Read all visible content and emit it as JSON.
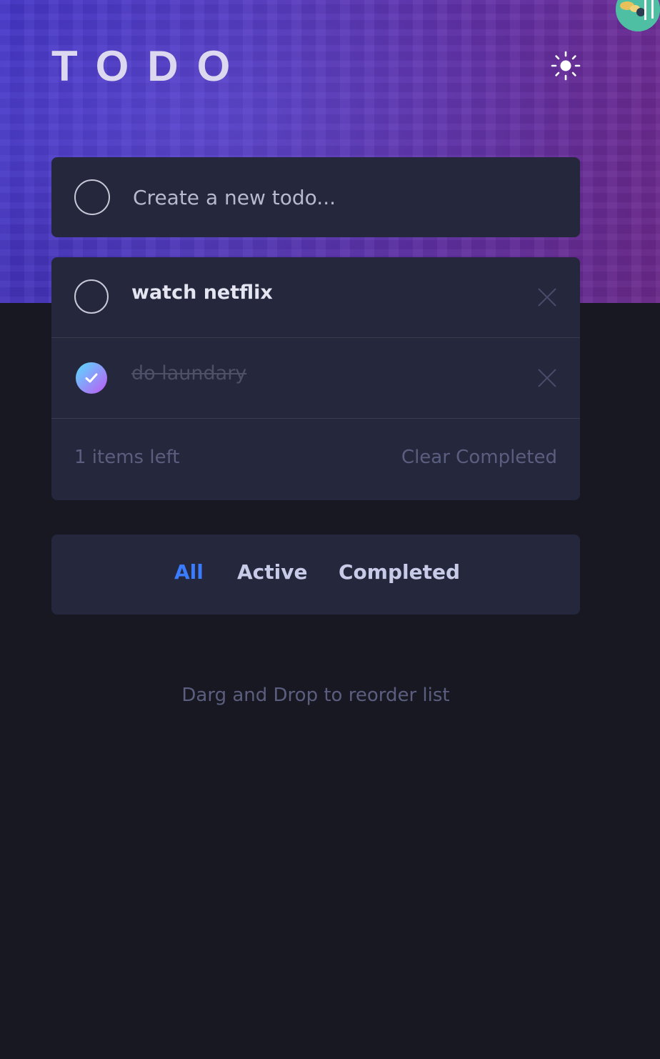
{
  "header": {
    "title": "TODO",
    "theme_icon": "sun-icon"
  },
  "new_todo": {
    "placeholder": "Create a new todo..."
  },
  "todos": [
    {
      "text": "watch netflix",
      "completed": false
    },
    {
      "text": "do laundary",
      "completed": true
    }
  ],
  "footer": {
    "items_left": "1 items left",
    "clear_label": "Clear Completed"
  },
  "filters": {
    "all": "All",
    "active": "Active",
    "completed": "Completed",
    "selected": "All"
  },
  "hint": "Darg and Drop to reorder list",
  "colors": {
    "accent": "#3a7cfd",
    "card": "#25273c",
    "background": "#171821",
    "check_gradient_start": "#57ddff",
    "check_gradient_end": "#c058f3"
  }
}
